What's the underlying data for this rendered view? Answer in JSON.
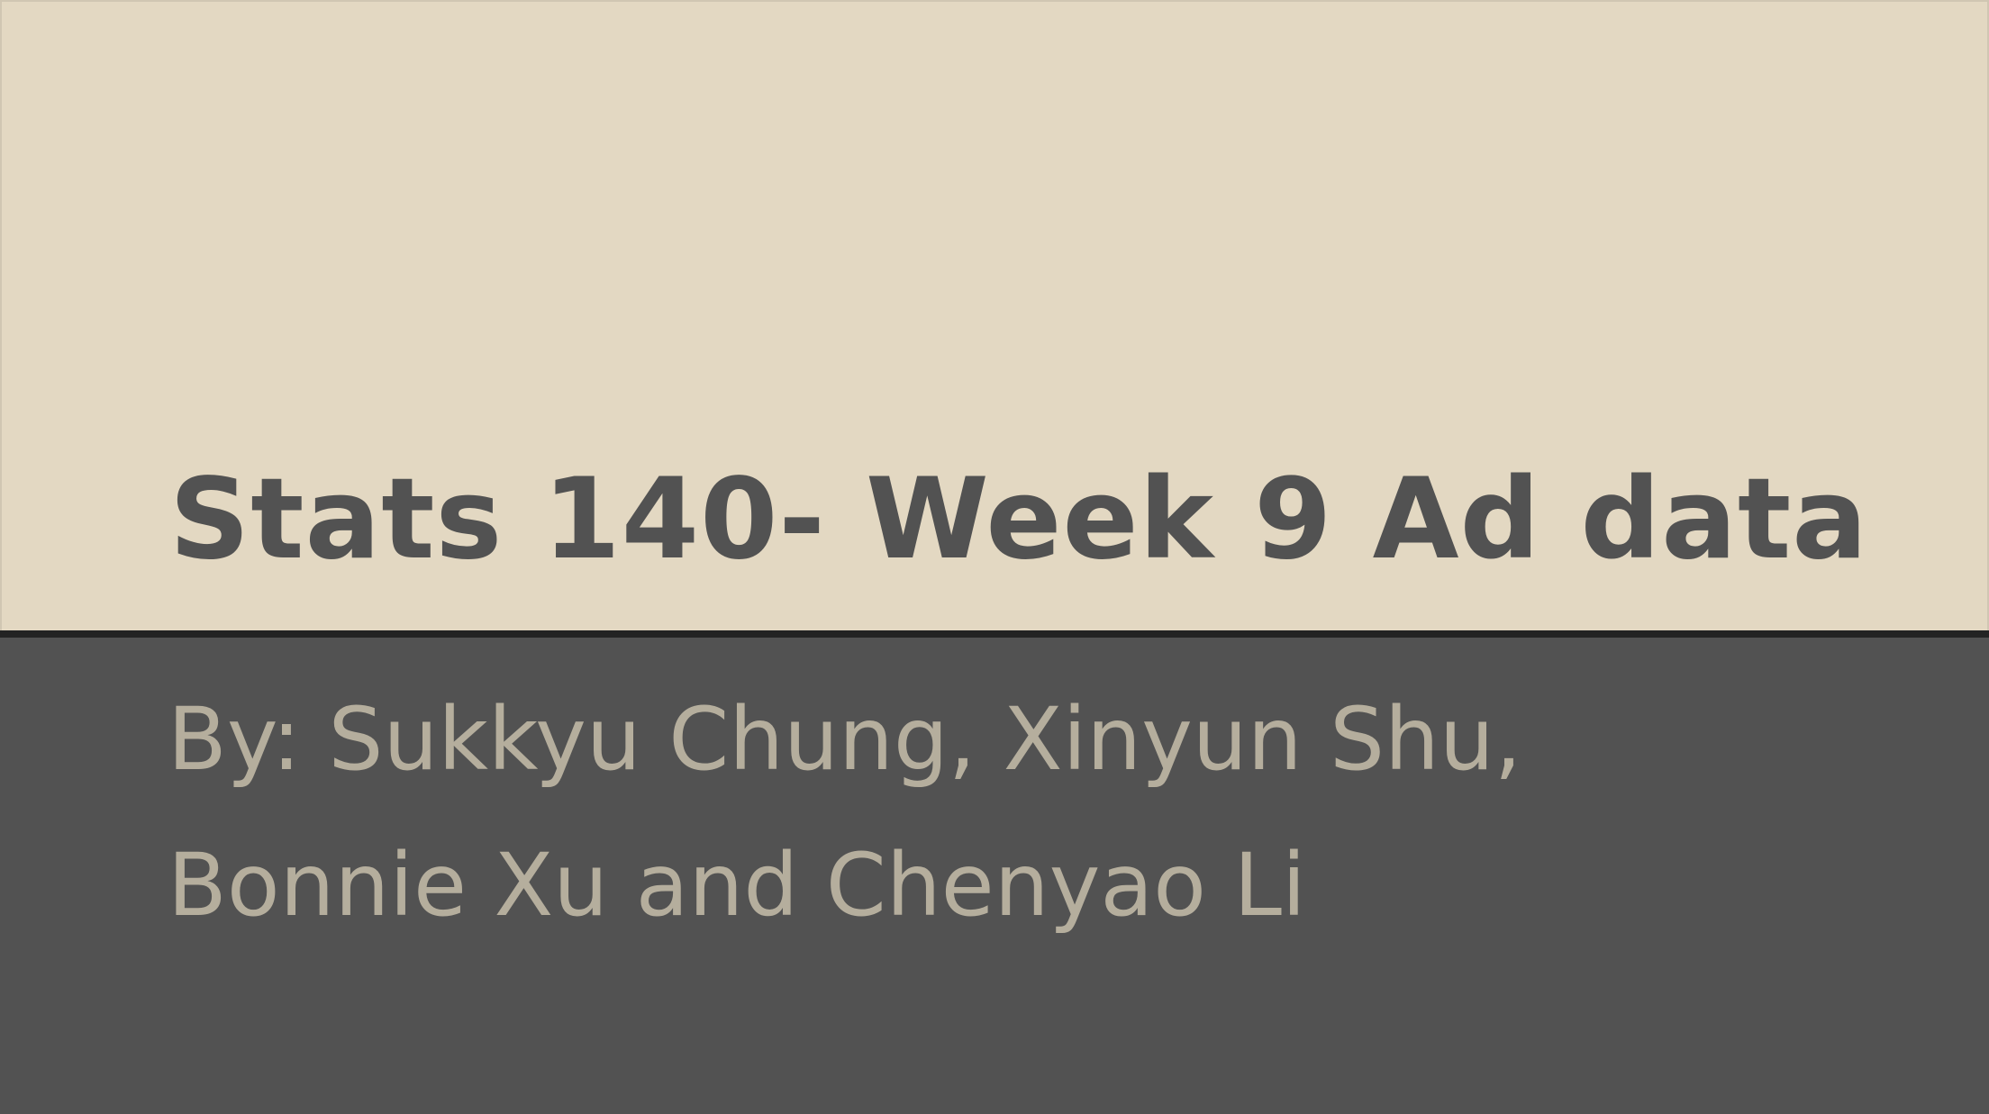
{
  "slide": {
    "title": "Stats 140- Week 9 Ad data",
    "subtitle_line1": "By: Sukkyu Chung, Xinyun Shu,",
    "subtitle_line2": "Bonnie Xu and Chenyao Li"
  },
  "colors": {
    "top_background": "#e3d8c2",
    "bottom_background": "#525252",
    "divider": "#232323",
    "title_text": "#525252",
    "subtitle_text": "#b5ae9d"
  }
}
